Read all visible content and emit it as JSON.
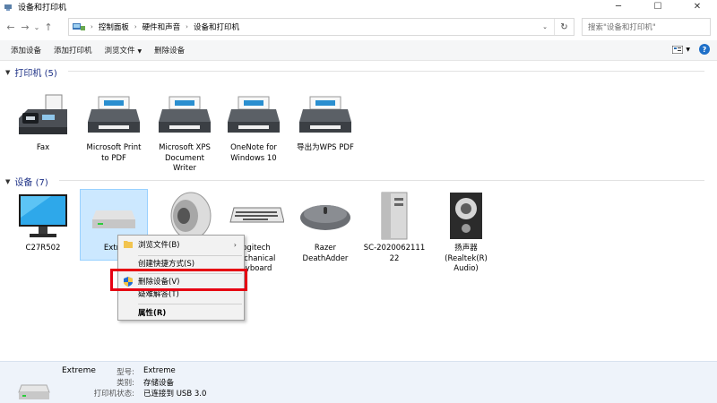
{
  "window": {
    "title": "设备和打印机",
    "minimize": "─",
    "maximize": "☐",
    "close": "✕"
  },
  "nav": {
    "back": "←",
    "forward": "→",
    "recent": "⌄",
    "up": "↑"
  },
  "address": {
    "crumbs": [
      "控制面板",
      "硬件和声音",
      "设备和打印机"
    ],
    "sep": "›",
    "dropdown": "⌄",
    "refresh": "↻"
  },
  "search": {
    "placeholder": "搜索\"设备和打印机\""
  },
  "toolbar": {
    "add_device": "添加设备",
    "add_printer": "添加打印机",
    "browse_files": "浏览文件",
    "remove_device": "删除设备",
    "help": "?"
  },
  "printers_group": {
    "title": "打印机 (5)",
    "items": [
      {
        "label": "Fax",
        "icon": "fax-icon"
      },
      {
        "label": "Microsoft Print\nto PDF",
        "icon": "printer-icon"
      },
      {
        "label": "Microsoft XPS\nDocument\nWriter",
        "icon": "printer-icon"
      },
      {
        "label": "OneNote for\nWindows 10",
        "icon": "printer-icon"
      },
      {
        "label": "导出为WPS PDF",
        "icon": "printer-icon"
      }
    ]
  },
  "devices_group": {
    "title": "设备 (7)",
    "items": [
      {
        "label": "C27R502",
        "icon": "monitor-icon"
      },
      {
        "label": "Extre",
        "icon": "drive-icon"
      },
      {
        "label": "",
        "icon": "speaker-icon"
      },
      {
        "label": "ogitech\nlechanical\neyboard",
        "icon": "keyboard-icon"
      },
      {
        "label": "Razer\nDeathAdder",
        "icon": "mouse-icon"
      },
      {
        "label": "SC-2020062111\n22",
        "icon": "computer-tower-icon"
      },
      {
        "label": "扬声器\n(Realtek(R)\nAudio)",
        "icon": "speaker-box-icon"
      }
    ]
  },
  "context_menu": {
    "browse_files": "浏览文件(B)",
    "create_shortcut": "创建快捷方式(S)",
    "remove_device": "删除设备(V)",
    "troubleshoot": "疑难解答(T)",
    "properties": "属性(R)",
    "submenu_arrow": "›"
  },
  "details": {
    "name": "Extreme",
    "fields": [
      {
        "key": "型号:",
        "value": "Extreme"
      },
      {
        "key": "类别:",
        "value": "存储设备"
      },
      {
        "key": "打印机状态:",
        "value": "已连接到 USB 3.0"
      }
    ]
  },
  "colors": {
    "accent": "#1e3287",
    "selection": "#cce8ff",
    "highlight_box": "#e60012",
    "details_bg": "#eef3fa"
  }
}
